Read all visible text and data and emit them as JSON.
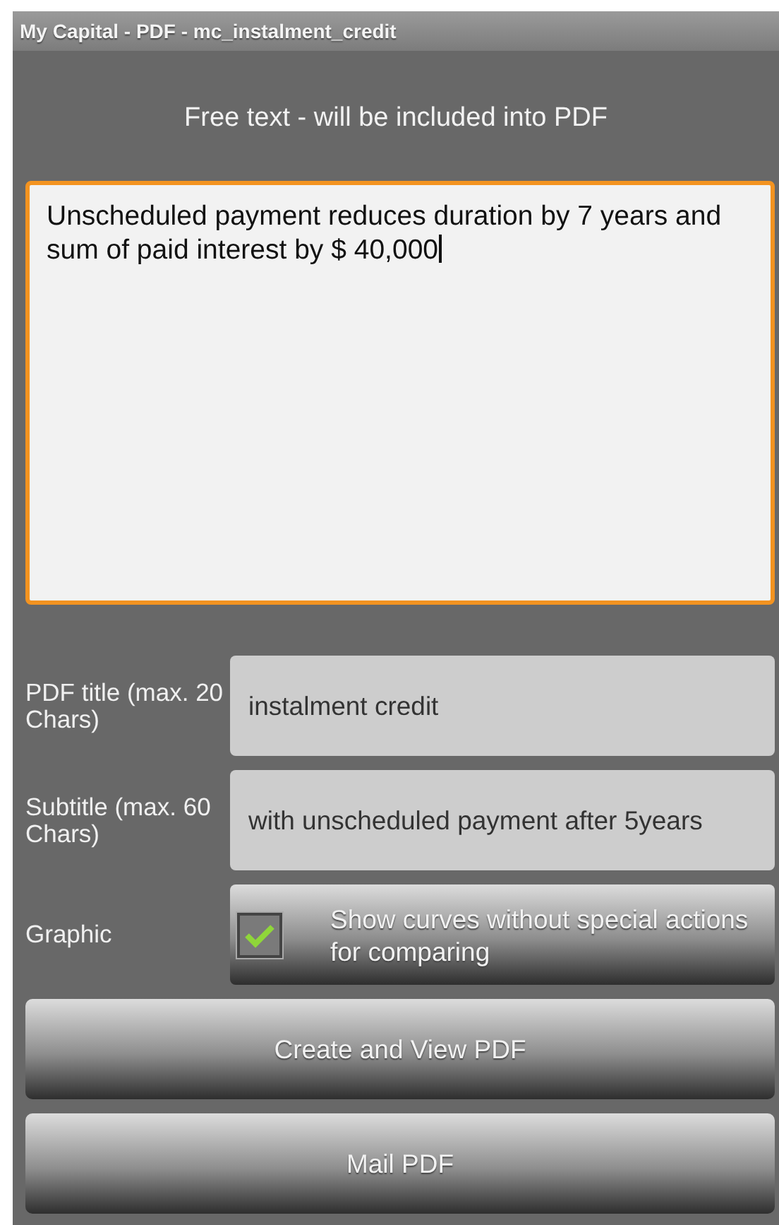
{
  "window": {
    "title": "My Capital - PDF - mc_instalment_credit"
  },
  "free_text": {
    "heading": "Free text - will be included into PDF",
    "value": "Unscheduled payment reduces duration by 7 years and sum of paid interest by $ 40,000",
    "focused": true
  },
  "fields": [
    {
      "label": "PDF title (max. 20 Chars)",
      "kind": "text",
      "value": "instalment credit"
    },
    {
      "label": "Subtitle (max. 60 Chars)",
      "kind": "text",
      "value": "with unscheduled payment after 5years"
    },
    {
      "label": "Graphic",
      "kind": "checkbox",
      "text": "Show curves without special actions for comparing",
      "checked": true
    }
  ],
  "buttons": [
    "Create and View PDF",
    "Mail PDF"
  ]
}
